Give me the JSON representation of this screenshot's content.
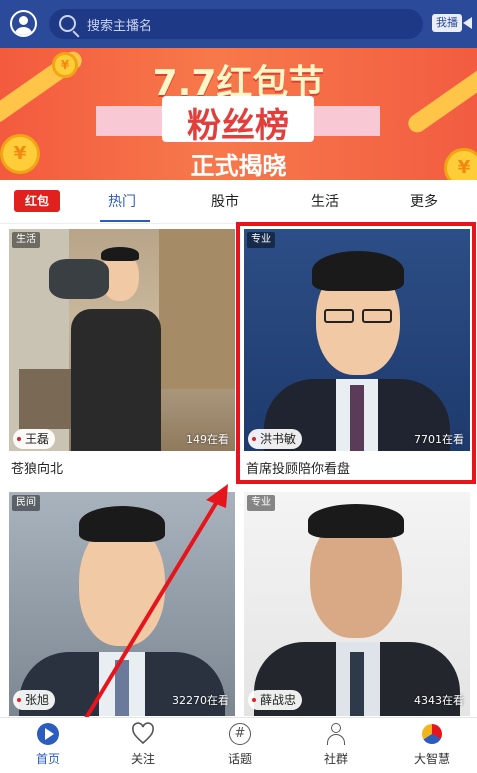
{
  "search": {
    "placeholder": "搜索主播名"
  },
  "top_right": {
    "live_label": "我播"
  },
  "banner": {
    "line1": "7.7红包节",
    "line2": "粉丝榜",
    "line3": "正式揭晓"
  },
  "tabs": {
    "redpack_label": "红包",
    "items": [
      {
        "label": "热门",
        "active": true
      },
      {
        "label": "股市"
      },
      {
        "label": "生活"
      },
      {
        "label": "更多"
      }
    ]
  },
  "cards": [
    {
      "tag": "生活",
      "host": "王磊",
      "viewers": "149在看",
      "caption": "苍狼向北"
    },
    {
      "tag": "专业",
      "host": "洪书敏",
      "viewers": "7701在看",
      "caption": "首席投顾陪你看盘"
    },
    {
      "tag": "民间",
      "host": "张旭",
      "viewers": "32270在看",
      "caption": ""
    },
    {
      "tag": "专业",
      "host": "薛战忠",
      "viewers": "4343在看",
      "caption": ""
    }
  ],
  "bottom_nav": [
    {
      "label": "首页",
      "icon": "play-circle-icon",
      "active": true
    },
    {
      "label": "关注",
      "icon": "heart-icon"
    },
    {
      "label": "话题",
      "icon": "hashtag-icon"
    },
    {
      "label": "社群",
      "icon": "group-icon"
    },
    {
      "label": "大智慧",
      "icon": "dzh-logo-icon"
    }
  ],
  "colors": {
    "brand_blue": "#2b4a9a",
    "accent_blue": "#2b5dbf",
    "highlight_red": "#e5151b"
  }
}
